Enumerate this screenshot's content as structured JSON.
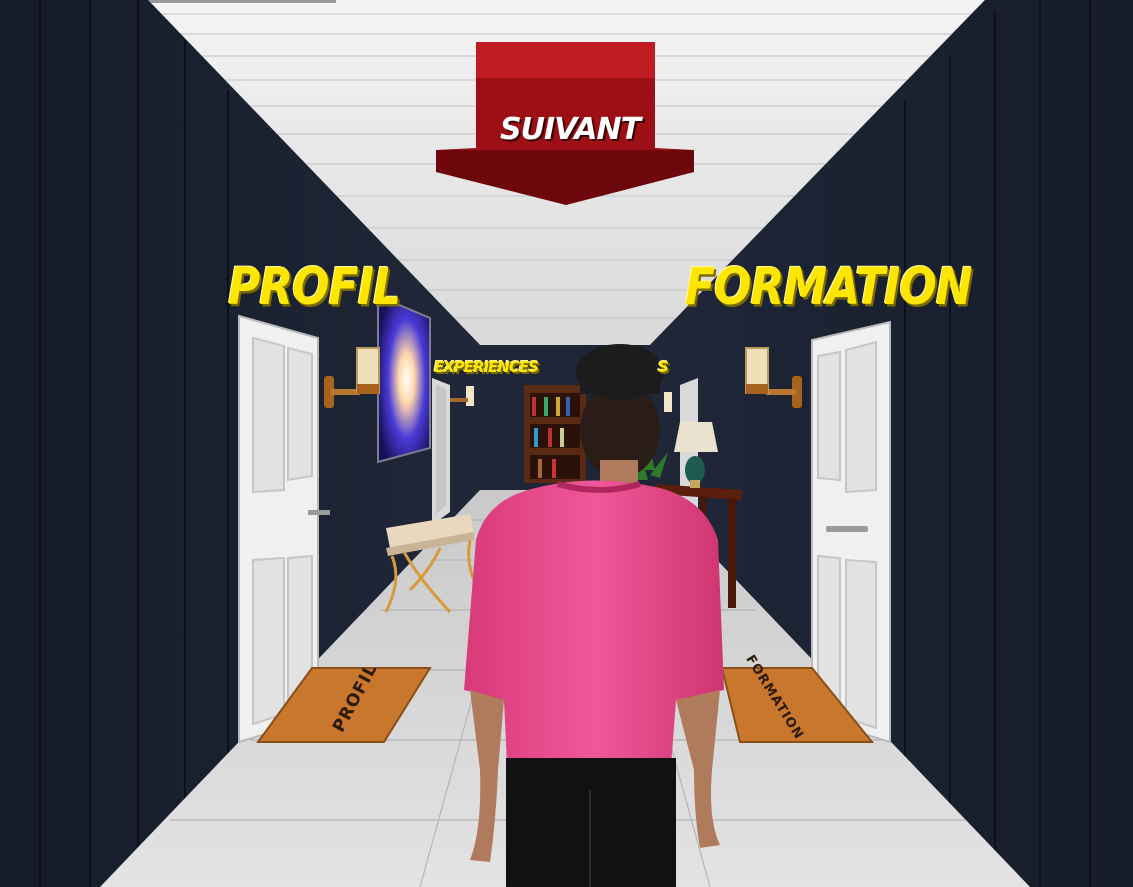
{
  "scene": {
    "signs": {
      "next_arrow": "SUIVANT",
      "left_door": "PROFIL",
      "right_door": "FORMATION",
      "far_left_door": "EXPERIENCES",
      "far_right_door": "S"
    },
    "doormats": {
      "left": "PROFIL",
      "right": "FORMATION"
    }
  },
  "colors": {
    "wall": "#1b2233",
    "ceiling": "#e6e6e6",
    "floor": "#d8d8d8",
    "sign_yellow": "#ffe600",
    "arrow_red": "#9b0f15",
    "shirt_pink": "#e84b8a",
    "door_white": "#e8e8e8",
    "doormat_brown": "#c8772c"
  },
  "icons": [
    "suivant-arrow-icon",
    "wall-lamp-icon",
    "table-lamp-icon",
    "plant-icon"
  ]
}
